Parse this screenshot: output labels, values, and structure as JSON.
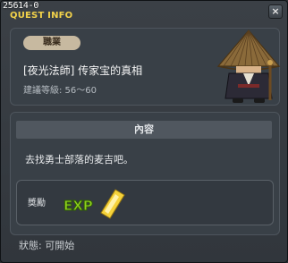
{
  "window": {
    "id_label": "25614-0",
    "title": "QUEST INFO",
    "close_label": "×"
  },
  "quest": {
    "job_badge": "職業",
    "name": "[夜光法師] 传家宝的真相",
    "level_text": "建議等級: 56～60"
  },
  "content": {
    "header": "內容",
    "text": "去找勇士部落的麦吉吧。"
  },
  "reward": {
    "label": "獎勵",
    "exp_text": "EXP"
  },
  "status": {
    "text": "狀態: 可開始"
  },
  "colors": {
    "title": "#f2d24a",
    "exp_green": "#8ed01d",
    "exp_yellow": "#f5d23a"
  }
}
